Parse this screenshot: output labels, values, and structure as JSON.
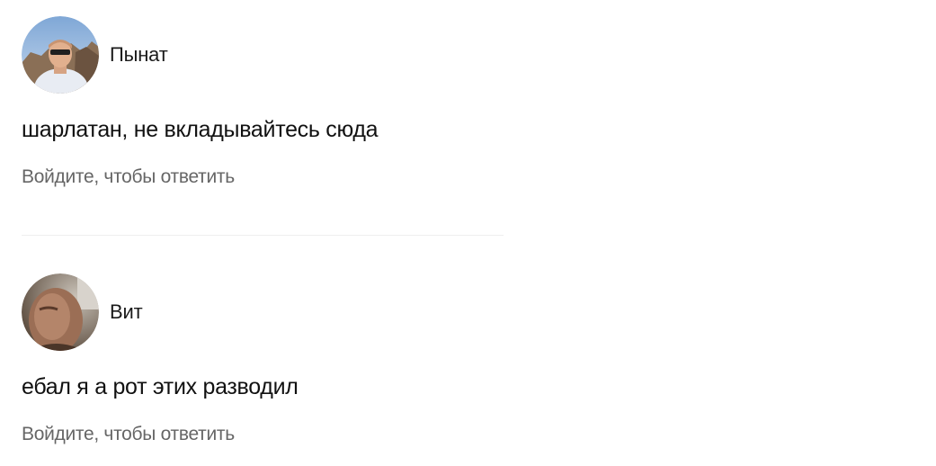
{
  "comments": [
    {
      "author": "Пынат",
      "text": "шарлатан, не вкладывайтесь сюда",
      "reply_label": "Войдите, чтобы ответить"
    },
    {
      "author": "Вит",
      "text": "ебал я а рот этих разводил",
      "reply_label": "Войдите, чтобы ответить"
    }
  ]
}
